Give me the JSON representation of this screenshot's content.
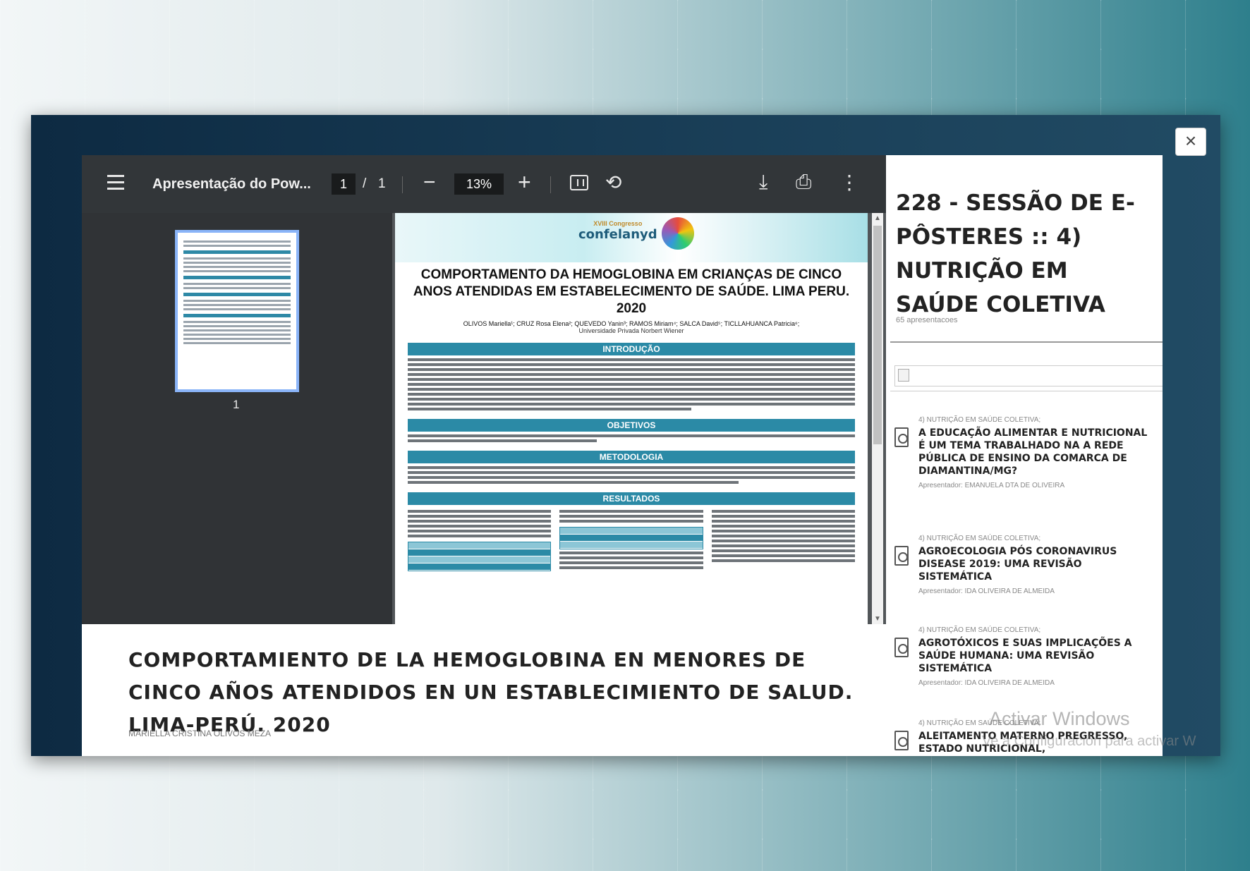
{
  "viewer": {
    "doc_title": "Apresentação do Pow...",
    "page_current": "1",
    "page_separator": "/",
    "page_total": "1",
    "zoom": "13%",
    "thumbnail_page_number": "1"
  },
  "poster": {
    "congress_label": "XVIII Congresso",
    "congress_name": "confelanyd",
    "title": "COMPORTAMENTO DA HEMOGLOBINA EM CRIANÇAS DE CINCO ANOS ATENDIDAS EM ESTABELECIMENTO DE SAÚDE. LIMA PERU. 2020",
    "authors": "OLIVOS Mariella¹; CRUZ Rosa Elena²; QUEVEDO Yanin³; RAMOS Miriam⁴; SALCA David⁵; TICLLAHUANCA Patricia⁶;",
    "institution": "Universidade Privada Norbert Wiener",
    "sections": [
      "INTRODUÇÃO",
      "OBJETIVOS",
      "METODOLOGIA",
      "RESULTADOS"
    ]
  },
  "caption": {
    "title": "COMPORTAMIENTO DE LA HEMOGLOBINA EN MENORES DE CINCO AÑOS ATENDIDOS EN UN ESTABLECIMIENTO DE SALUD. LIMA-PERÚ. 2020",
    "author": "MARIELLA CRISTINA OLIVOS MEZA"
  },
  "side": {
    "session_title": "228 - SESSÃO DE E-PÔSTERES :: 4) NUTRIÇÃO EM SAÚDE COLETIVA",
    "session_count": "65 apresentacoes",
    "presentations": [
      {
        "category": "4) NUTRIÇÃO EM SAÚDE COLETIVA;",
        "title": "A EDUCAÇÃO ALIMENTAR E NUTRICIONAL É UM TEMA TRABALHADO NA A REDE PÚBLICA DE ENSINO DA COMARCA DE DIAMANTINA/MG?",
        "presenter": "Apresentador: EMANUELA DTA DE OLIVEIRA"
      },
      {
        "category": "4) NUTRIÇÃO EM SAÚDE COLETIVA;",
        "title": "AGROECOLOGIA PÓS CORONAVIRUS DISEASE 2019: UMA REVISÃO SISTEMÁTICA",
        "presenter": "Apresentador: IDA OLIVEIRA DE ALMEIDA"
      },
      {
        "category": "4) NUTRIÇÃO EM SAÚDE COLETIVA;",
        "title": "AGROTÓXICOS E SUAS IMPLICAÇÕES A SAÚDE HUMANA: UMA REVISÃO SISTEMÁTICA",
        "presenter": "Apresentador: IDA OLIVEIRA DE ALMEIDA"
      },
      {
        "category": "4) NUTRIÇÃO EM SAÚDE COLETIVA;",
        "title": "ALEITAMENTO MATERNO PREGRESSO, ESTADO NUTRICIONAL,",
        "presenter": ""
      }
    ]
  },
  "watermark": {
    "line1": "Activar Windows",
    "line2": "Ve a Configuración para activar W"
  },
  "close_label": "×"
}
